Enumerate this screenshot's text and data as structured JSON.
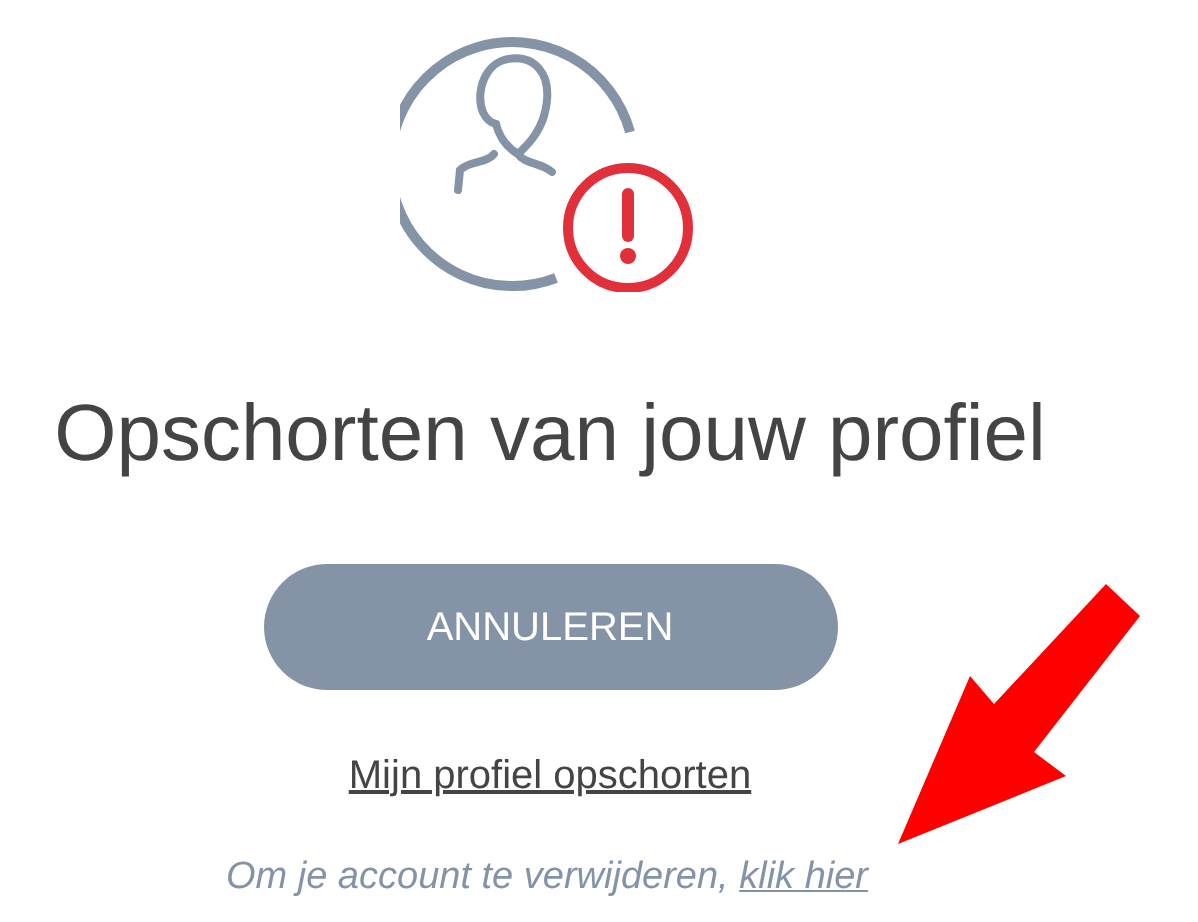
{
  "title": "Opschorten van jouw profiel",
  "cancel_button": "ANNULEREN",
  "suspend_link": "Mijn profiel opschorten",
  "delete_note": {
    "text": "Om je account te verwijderen,",
    "link": "klik hier"
  }
}
